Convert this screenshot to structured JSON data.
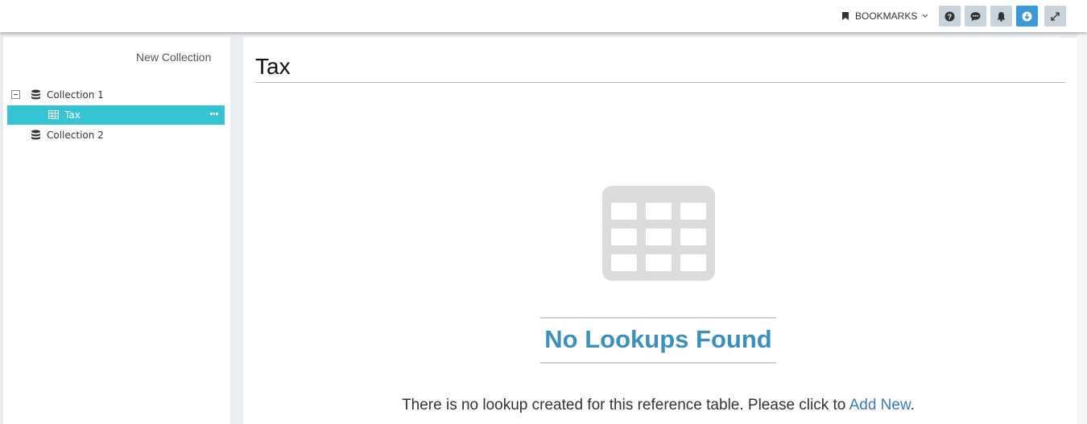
{
  "topbar": {
    "bookmarks_label": "BOOKMARKS",
    "buttons": [
      "help-icon",
      "chat-icon",
      "bell-icon",
      "download-icon",
      "expand-icon"
    ],
    "active_button_color": "#3a9ad9"
  },
  "sidebar": {
    "new_collection_label": "New Collection",
    "tree": [
      {
        "label": "Collection 1",
        "icon": "database-icon",
        "expanded": true
      },
      {
        "label": "Tax",
        "icon": "table-icon",
        "selected": true
      },
      {
        "label": "Collection 2",
        "icon": "database-icon"
      }
    ],
    "selected_color": "#35c4d4"
  },
  "main": {
    "title": "Tax",
    "empty_state": {
      "icon": "table-grid-icon",
      "heading": "No Lookups Found",
      "message": "There is no lookup created for this reference table. Please click to",
      "link_label": "Add New",
      "message_end": "."
    },
    "heading_color": "#3b91ba"
  }
}
